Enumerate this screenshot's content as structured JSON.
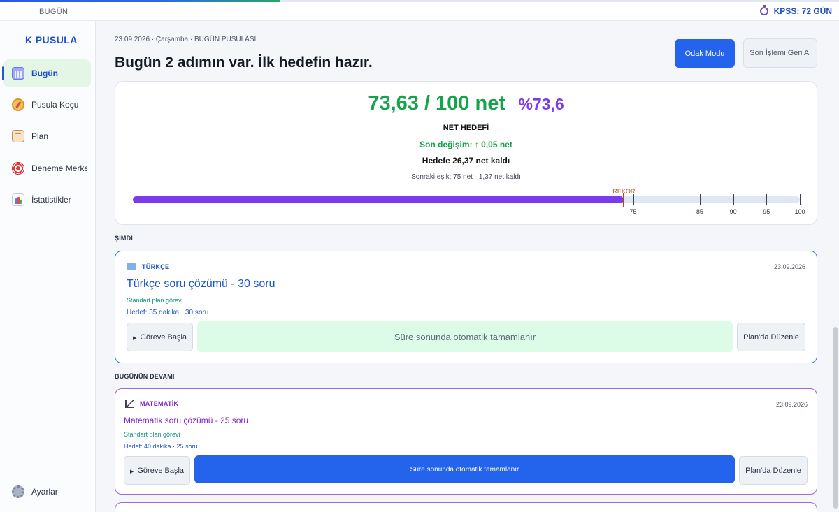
{
  "topbar": {
    "title": "BUGÜN",
    "progress": 0.333,
    "countdown": "KPSS: 72 GÜN"
  },
  "sidebar": {
    "logo": "K PUSULA",
    "items": [
      {
        "label": "Bugün",
        "icon": "calendar-icon",
        "active": true
      },
      {
        "label": "Pusula Koçu",
        "icon": "compass-icon",
        "active": false
      },
      {
        "label": "Plan",
        "icon": "clipboard-icon",
        "active": false
      },
      {
        "label": "Deneme Merkezi",
        "icon": "target-icon",
        "active": false
      },
      {
        "label": "İstatistikler",
        "icon": "bar-chart-icon",
        "active": false
      }
    ],
    "settings_label": "Ayarlar"
  },
  "header": {
    "crumb": "23.09.2026 · Çarşamba · BUGÜN PUSULASI",
    "headline": "Bugün 2 adımın var. İlk hedefin hazır.",
    "focus_button": "Odak Modu",
    "undo_button": "Son İşlemi Geri Al"
  },
  "net": {
    "value": "73,63 / 100 net",
    "percent": "%73,6",
    "label": "NET HEDEFİ",
    "change": "Son değişim: ↑ 0,05 net",
    "remaining": "Hedefe 26,37 net kaldı",
    "next_threshold": "Sonraki eşik: 75 net · 1,37 net kaldı",
    "progress_value": 73.63,
    "record_value": 73.63,
    "record_label": "REKOR",
    "ticks": [
      "75",
      "85",
      "90",
      "95",
      "100"
    ]
  },
  "sections": {
    "now": "ŞİMDİ",
    "rest": "BUGÜNÜN DEVAMI"
  },
  "tasks": [
    {
      "subject": "TÜRKÇE",
      "date": "23.09.2026",
      "title": "Türkçe soru çözümü - 30 soru",
      "sub": "Standart plan görevi",
      "goal": "Hedef: 35 dakika · 30 soru",
      "start_button": "Göreve Başla",
      "auto_text": "Süre sonunda otomatik tamamlanır",
      "edit_button": "Plan'da Düzenle",
      "accent": "#1d56c9"
    },
    {
      "subject": "MATEMATİK",
      "date": "23.09.2026",
      "title": "Matematik soru çözümü - 25 soru",
      "sub": "Standart plan görevi",
      "goal": "Hedef: 40 dakika · 25 soru",
      "start_button": "Göreve Başla",
      "auto_text": "Süre sonunda otomatik tamamlanır",
      "edit_button": "Plan'da Düzenle",
      "accent": "#7e22ce"
    }
  ],
  "colors": {
    "primary": "#2463eb",
    "success": "#16a34a",
    "purple": "#7c3aed",
    "record": "#c2410c"
  }
}
